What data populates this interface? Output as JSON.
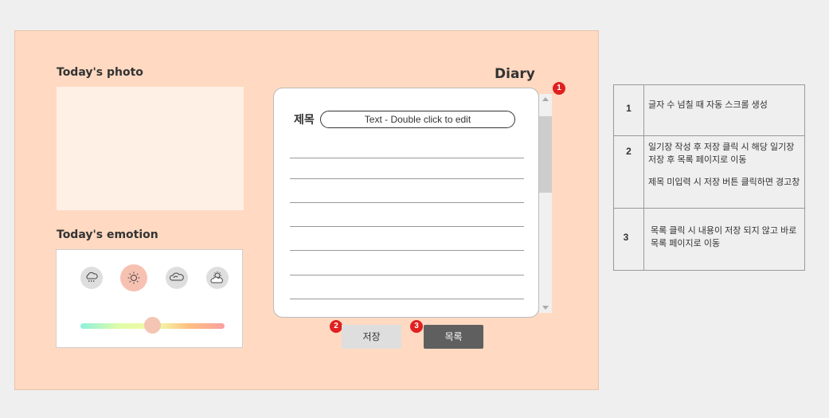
{
  "photo": {
    "label": "Today's photo"
  },
  "emotion": {
    "label": "Today's emotion",
    "icons": [
      "rain-cloud-icon",
      "sun-icon",
      "cloud-icon",
      "partly-cloudy-icon"
    ],
    "selected": "sun-icon",
    "slider_value": 0.5,
    "slider_colors": [
      "#8ff0dc",
      "#e2fda5",
      "#f1f7a6",
      "#ffbf80",
      "#f9a0a0"
    ]
  },
  "diary": {
    "title": "Diary",
    "title_field_label": "제목",
    "title_placeholder": "Text - Double click to edit",
    "save_label": "저장",
    "list_label": "목록"
  },
  "badges": {
    "scroll": "1",
    "save": "2",
    "list": "3"
  },
  "spec": [
    {
      "num": "1",
      "text": "글자 수 넘칠 때 자동 스크롤 생성"
    },
    {
      "num": "2",
      "text": "일기장 작성 후 저장 클릭 시 해당 일기장 저장 후 목록 페이지로 이동",
      "text2": "제목 미입력 시 저장 버튼 클릭하면 경고창"
    },
    {
      "num": "3",
      "text": "목록 클릭 시 내용이 저장 되지 않고 바로 목록 페이지로 이동"
    }
  ],
  "colors": {
    "background": "#ffd9c1",
    "badge": "#e02020",
    "list_button": "#5f5f5f"
  }
}
